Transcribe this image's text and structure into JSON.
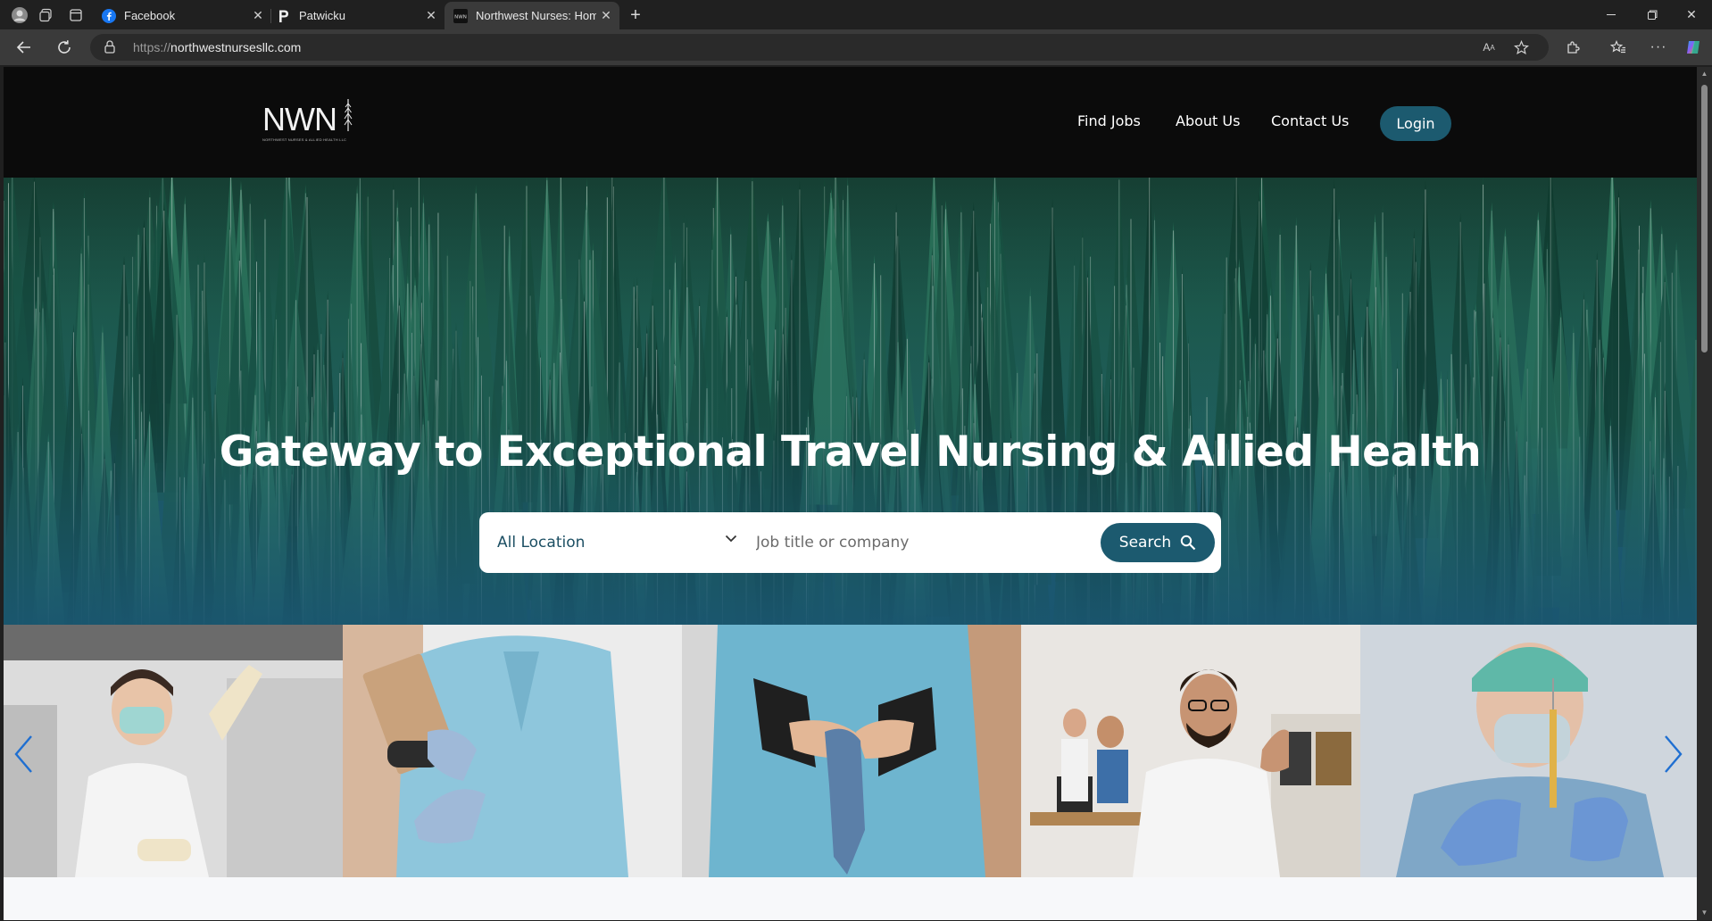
{
  "browser": {
    "tabs": [
      {
        "title": "Facebook",
        "favicon": "facebook-icon"
      },
      {
        "title": "Patwicku",
        "favicon": "patreon-icon"
      },
      {
        "title": "Northwest Nurses: Home",
        "favicon": "nwn-icon",
        "active": true
      }
    ],
    "url_scheme": "https://",
    "url_host": "northwestnursesllc.com"
  },
  "site": {
    "logo_text": "NWN",
    "logo_tagline": "NORTHWEST NURSES & ALLIED HEALTH LLC",
    "nav": {
      "find_jobs": "Find Jobs",
      "about_us": "About Us",
      "contact_us": "Contact Us",
      "login": "Login"
    },
    "hero": {
      "title": "Gateway to Exceptional Travel Nursing & Allied Health"
    },
    "search": {
      "location_value": "All Location",
      "job_placeholder": "Job title or company",
      "search_label": "Search"
    },
    "colors": {
      "brand_teal": "#1c5a6f",
      "header_bg": "#0b0b0b"
    }
  }
}
